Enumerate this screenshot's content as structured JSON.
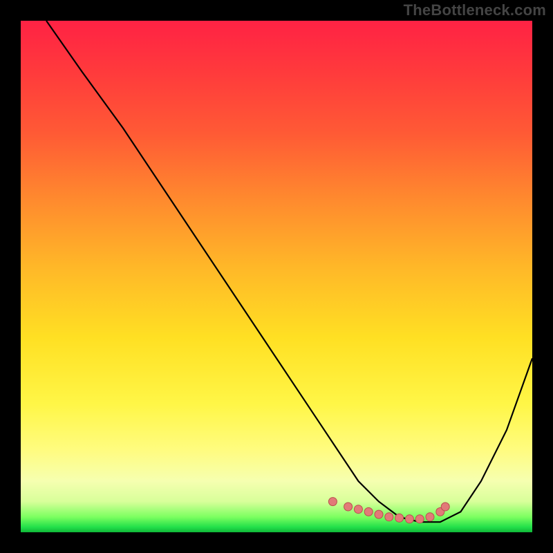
{
  "watermark": "TheBottleneck.com",
  "chart_data": {
    "type": "line",
    "title": "",
    "xlabel": "",
    "ylabel": "",
    "xlim": [
      0,
      100
    ],
    "ylim": [
      0,
      100
    ],
    "series": [
      {
        "name": "curve",
        "x": [
          5,
          12,
          20,
          30,
          40,
          50,
          58,
          62,
          66,
          70,
          74,
          78,
          82,
          86,
          90,
          95,
          100
        ],
        "y": [
          100,
          90,
          79,
          64,
          49,
          34,
          22,
          16,
          10,
          6,
          3,
          2,
          2,
          4,
          10,
          20,
          34
        ]
      }
    ],
    "marker_points": {
      "name": "highlight-dots",
      "x": [
        61,
        64,
        66,
        68,
        70,
        72,
        74,
        76,
        78,
        80,
        82,
        83
      ],
      "y": [
        6,
        5,
        4.5,
        4,
        3.5,
        3,
        2.8,
        2.6,
        2.6,
        3,
        4,
        5
      ]
    }
  }
}
